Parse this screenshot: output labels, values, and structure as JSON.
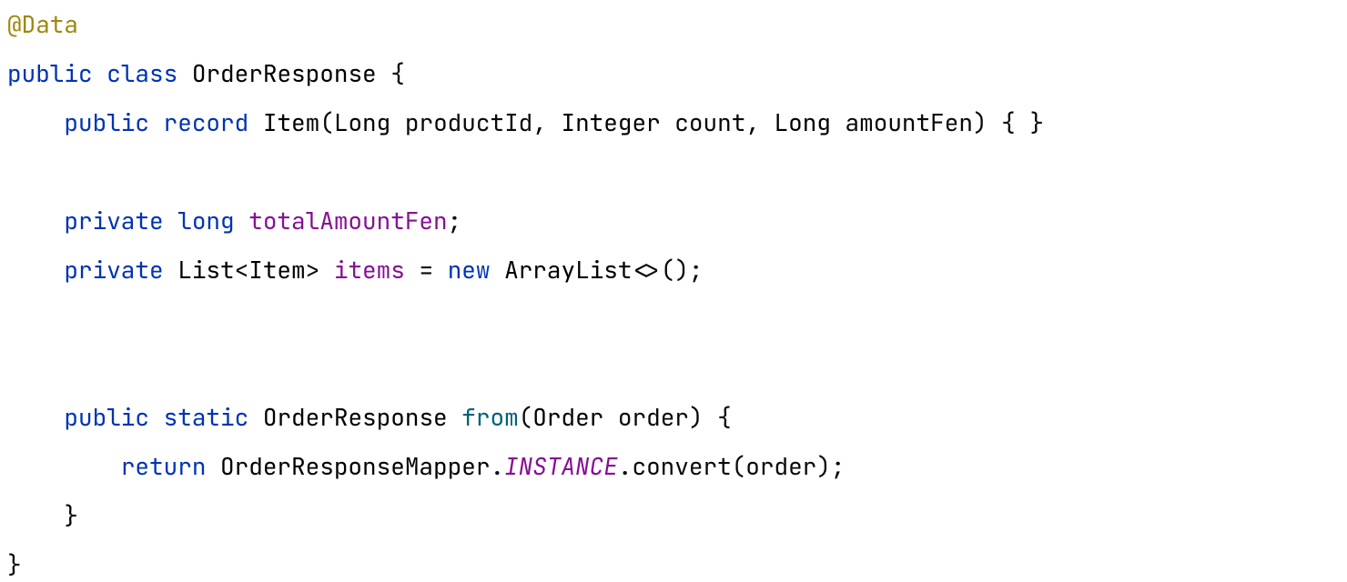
{
  "code": {
    "annotation": "@Data",
    "kw_public1": "public",
    "kw_class": "class",
    "cls_name": "OrderResponse",
    "brace_open": "{",
    "kw_public2": "public",
    "kw_record": "record",
    "rec_name": "Item",
    "rec_params_open": "(",
    "rec_p1_t": "Long",
    "rec_p1_n": "productId",
    "rec_c1": ", ",
    "rec_p2_t": "Integer",
    "rec_p2_n": "count",
    "rec_c2": ", ",
    "rec_p3_t": "Long",
    "rec_p3_n": "amountFen",
    "rec_params_close": ")",
    "rec_body": " { }",
    "kw_private1": "private",
    "kw_long": "long",
    "field1": "totalAmountFen",
    "semi1": ";",
    "kw_private2": "private",
    "type_list": "List",
    "lt": "<",
    "type_item": "Item",
    "gt": ">",
    "field2": "items",
    "eq": " = ",
    "kw_new": "new",
    "type_arraylist": "ArrayList",
    "diamond": "<>();",
    "kw_public3": "public",
    "kw_static": "static",
    "ret_type": "OrderResponse",
    "method_name": "from",
    "mparams_open": "(",
    "mp_t": "Order",
    "mp_n": "order",
    "mparams_close": ")",
    "mbrace_open": " {",
    "kw_return": "return",
    "mapper": "OrderResponseMapper",
    "dot1": ".",
    "instance": "INSTANCE",
    "dot2": ".",
    "convert": "convert",
    "call": "(order);",
    "mbrace_close": "}",
    "brace_close": "}"
  }
}
